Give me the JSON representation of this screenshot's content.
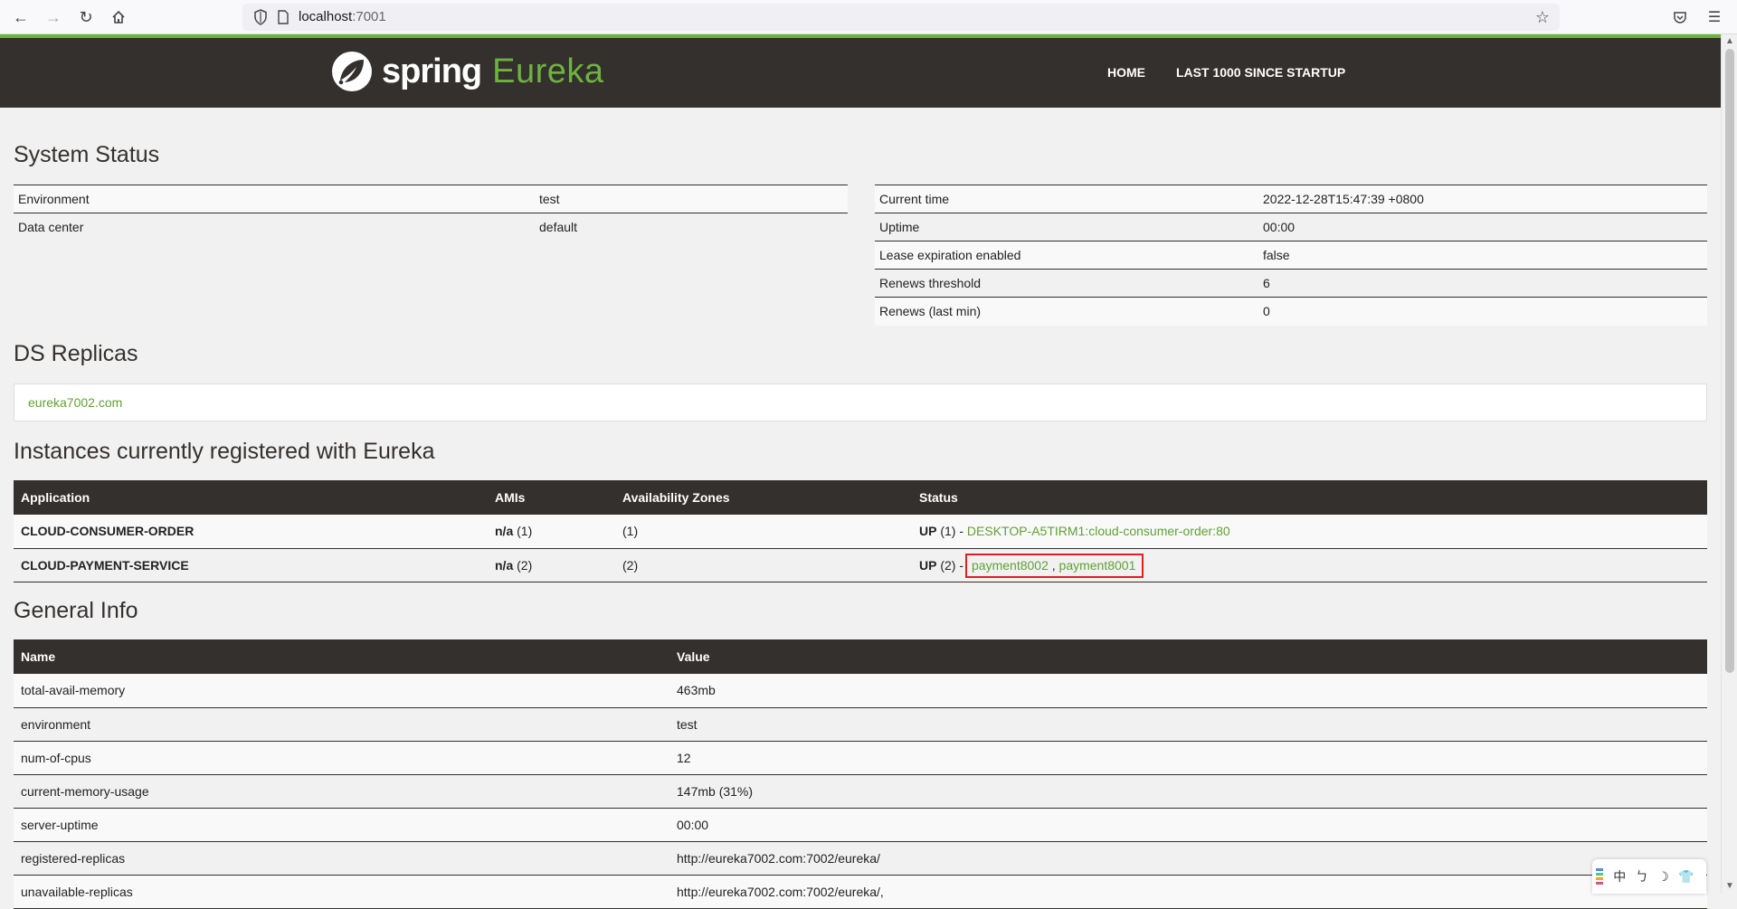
{
  "browser": {
    "url_host": "localhost",
    "url_port": ":7001"
  },
  "navbar": {
    "brand_spring": "spring",
    "brand_eureka": "Eureka",
    "links": [
      "HOME",
      "LAST 1000 SINCE STARTUP"
    ]
  },
  "system_status": {
    "title": "System Status",
    "left": [
      {
        "label": "Environment",
        "value": "test"
      },
      {
        "label": "Data center",
        "value": "default"
      }
    ],
    "right": [
      {
        "label": "Current time",
        "value": "2022-12-28T15:47:39 +0800"
      },
      {
        "label": "Uptime",
        "value": "00:00"
      },
      {
        "label": "Lease expiration enabled",
        "value": "false"
      },
      {
        "label": "Renews threshold",
        "value": "6"
      },
      {
        "label": "Renews (last min)",
        "value": "0"
      }
    ]
  },
  "ds_replicas": {
    "title": "DS Replicas",
    "link": "eureka7002.com"
  },
  "instances": {
    "title": "Instances currently registered with Eureka",
    "headers": [
      "Application",
      "AMIs",
      "Availability Zones",
      "Status"
    ],
    "rows": [
      {
        "application": "CLOUD-CONSUMER-ORDER",
        "ami_bold": "n/a",
        "ami_count": "(1)",
        "zones": "(1)",
        "status_bold": "UP",
        "status_count": "(1) -",
        "instance_links": [
          "DESKTOP-A5TIRM1:cloud-consumer-order:80"
        ]
      },
      {
        "application": "CLOUD-PAYMENT-SERVICE",
        "ami_bold": "n/a",
        "ami_count": "(2)",
        "zones": "(2)",
        "status_bold": "UP",
        "status_count": "(2) -",
        "instance_links": [
          "payment8002",
          "payment8001"
        ],
        "link_separator": ","
      }
    ]
  },
  "general_info": {
    "title": "General Info",
    "headers": [
      "Name",
      "Value"
    ],
    "rows": [
      {
        "name": "total-avail-memory",
        "value": "463mb"
      },
      {
        "name": "environment",
        "value": "test"
      },
      {
        "name": "num-of-cpus",
        "value": "12"
      },
      {
        "name": "current-memory-usage",
        "value": "147mb (31%)"
      },
      {
        "name": "server-uptime",
        "value": "00:00"
      },
      {
        "name": "registered-replicas",
        "value": "http://eureka7002.com:7002/eureka/"
      },
      {
        "name": "unavailable-replicas",
        "value": "http://eureka7002.com:7002/eureka/,"
      }
    ]
  },
  "ime": {
    "chars": [
      "中",
      "ㄅ",
      "☽",
      "👕"
    ]
  },
  "colors": {
    "brand_green": "#6db33f",
    "navbar_bg": "#34302d",
    "link_green": "#5fa134",
    "highlight_red": "#e0201f"
  }
}
